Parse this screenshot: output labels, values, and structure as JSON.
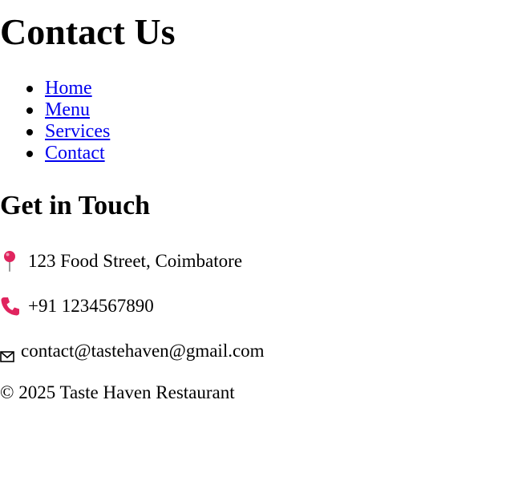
{
  "header": {
    "title": "Contact Us"
  },
  "nav": {
    "items": [
      {
        "label": "Home"
      },
      {
        "label": "Menu"
      },
      {
        "label": "Services"
      },
      {
        "label": "Contact"
      }
    ]
  },
  "contact": {
    "heading": "Get in Touch",
    "address": {
      "icon": "pin-icon",
      "text": "123 Food Street, Coimbatore"
    },
    "phone": {
      "icon": "phone-icon",
      "text": "+91 1234567890"
    },
    "email": {
      "icon": "mail-icon",
      "text": "contact@tastehaven@gmail.com"
    }
  },
  "footer": {
    "text": "© 2025 Taste Haven Restaurant"
  },
  "colors": {
    "link": "#0000EE",
    "text": "#000000",
    "background": "#FFFFFF",
    "pin": "#E0245E",
    "phone": "#E0245E"
  }
}
